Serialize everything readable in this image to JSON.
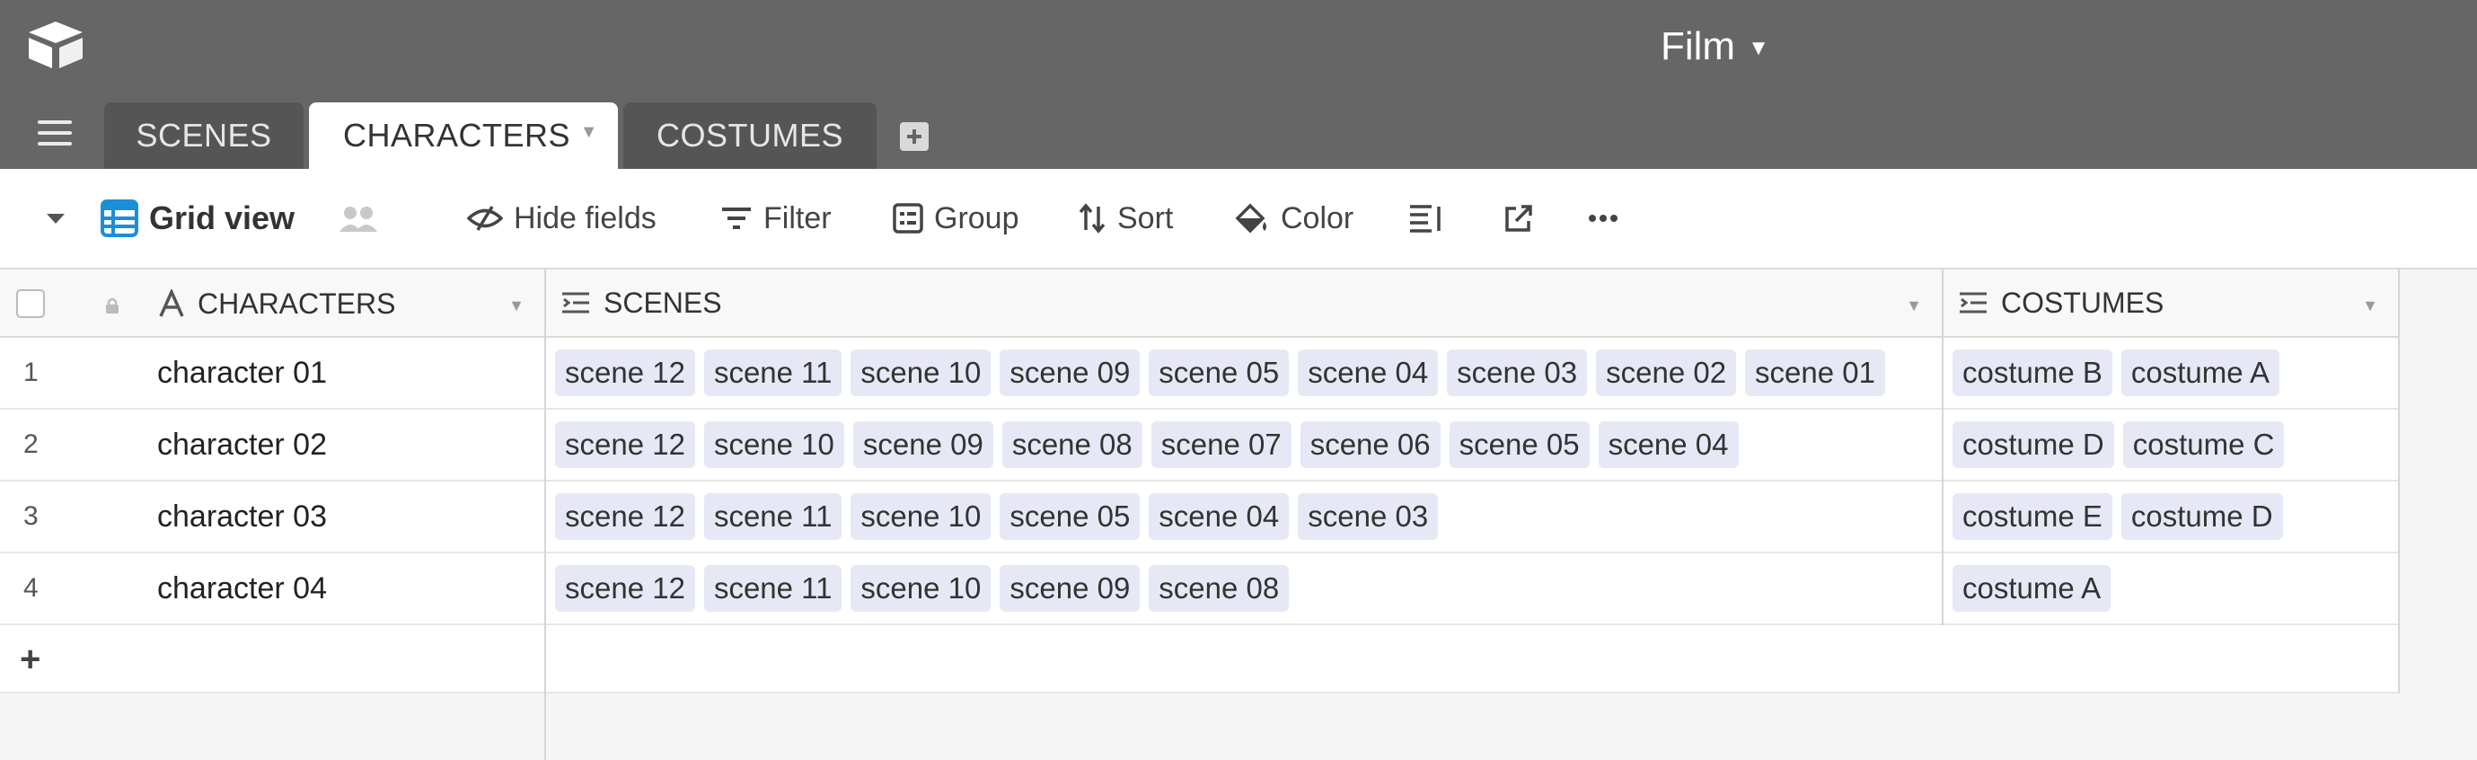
{
  "base": {
    "title": "Film"
  },
  "tabs": [
    {
      "label": "SCENES"
    },
    {
      "label": "CHARACTERS"
    },
    {
      "label": "COSTUMES"
    }
  ],
  "toolbar": {
    "view_name": "Grid view",
    "hide_fields": "Hide fields",
    "filter": "Filter",
    "group": "Group",
    "sort": "Sort",
    "color": "Color"
  },
  "columns": {
    "primary": "CHARACTERS",
    "scenes": "SCENES",
    "costumes": "COSTUMES"
  },
  "rows": [
    {
      "num": "1",
      "name": "character 01",
      "scenes": [
        "scene 12",
        "scene 11",
        "scene 10",
        "scene 09",
        "scene 05",
        "scene 04",
        "scene 03",
        "scene 02",
        "scene 01"
      ],
      "costumes": [
        "costume B",
        "costume A"
      ]
    },
    {
      "num": "2",
      "name": "character 02",
      "scenes": [
        "scene 12",
        "scene 10",
        "scene 09",
        "scene 08",
        "scene 07",
        "scene 06",
        "scene 05",
        "scene 04"
      ],
      "costumes": [
        "costume D",
        "costume C"
      ]
    },
    {
      "num": "3",
      "name": "character 03",
      "scenes": [
        "scene 12",
        "scene 11",
        "scene 10",
        "scene 05",
        "scene 04",
        "scene 03"
      ],
      "costumes": [
        "costume E",
        "costume D"
      ]
    },
    {
      "num": "4",
      "name": "character 04",
      "scenes": [
        "scene 12",
        "scene 11",
        "scene 10",
        "scene 09",
        "scene 08"
      ],
      "costumes": [
        "costume A"
      ]
    }
  ],
  "add_row_symbol": "+",
  "colors": {
    "header_bg": "#666666",
    "tab_inactive": "#555555",
    "chip_bg": "#e6e9f5",
    "view_icon": "#1b8fd8"
  },
  "icons": [
    "airtable-logo-icon",
    "menu-icon",
    "add-table-icon",
    "collapse-caret-icon",
    "grid-view-icon",
    "share-view-icon",
    "hide-fields-icon",
    "filter-icon",
    "group-icon",
    "sort-icon",
    "color-icon",
    "row-height-icon",
    "share-icon",
    "more-icon",
    "lock-icon",
    "text-field-icon",
    "linked-record-icon"
  ]
}
